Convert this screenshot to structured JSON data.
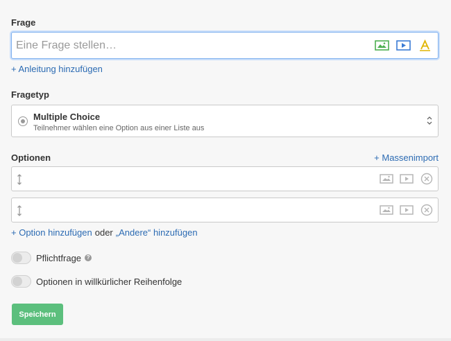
{
  "question": {
    "label": "Frage",
    "placeholder": "Eine Frage stellen…",
    "value": "",
    "icons": [
      "image-icon",
      "video-icon",
      "font-icon"
    ],
    "add_guide": "+ Anleitung hinzufügen"
  },
  "question_type": {
    "label": "Fragetyp",
    "title": "Multiple Choice",
    "description": "Teilnehmer wählen eine Option aus einer Liste aus"
  },
  "options": {
    "label": "Optionen",
    "bulk_import": "+ Massenimport",
    "items": [
      {
        "value": ""
      },
      {
        "value": ""
      }
    ],
    "add_option": "+ Option hinzufügen",
    "or": "oder",
    "add_other": "„Andere“ hinzufügen"
  },
  "settings": {
    "required_label": "Pflichtfrage",
    "random_order_label": "Optionen in willkürlicher Reihenfolge"
  },
  "save_label": "Speichern",
  "colors": {
    "accent_blue": "#2c6bb3",
    "save_green": "#5cbf7d",
    "image_icon": "#4caf50",
    "video_icon": "#3a7bd5",
    "font_icon": "#e0b400"
  }
}
